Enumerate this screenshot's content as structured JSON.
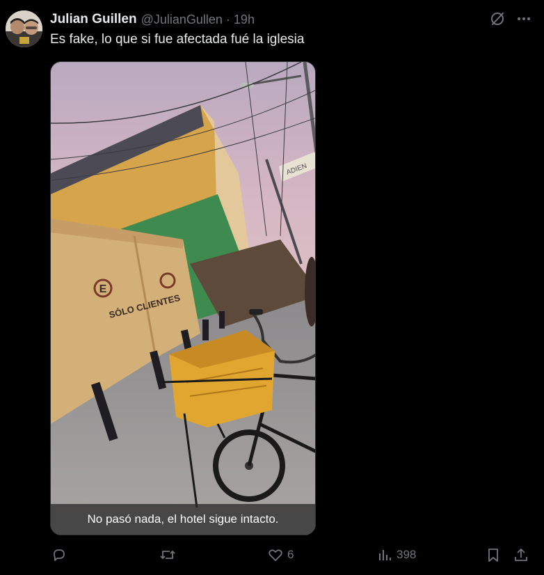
{
  "tweet": {
    "display_name": "Julian Guillen",
    "handle": "@JulianGullen",
    "separator": "·",
    "time": "19h",
    "text": "Es fake, lo que si fue afectada fué la iglesia",
    "more_icon": "more-horizontal-icon",
    "grok_icon": "grok-slash-icon"
  },
  "media": {
    "caption": "No pasó nada, el hotel sigue intacto.",
    "sign_line1": "SÓLO CLIENTES",
    "sign_letter": "E",
    "sign_overhead": "ADIEN"
  },
  "actions": {
    "reply_icon": "reply-icon",
    "repost_icon": "repost-icon",
    "like_icon": "heart-icon",
    "like_count": "6",
    "views_icon": "views-bar-chart-icon",
    "views_count": "398",
    "bookmark_icon": "bookmark-icon",
    "share_icon": "share-icon"
  },
  "colors": {
    "background": "#000000",
    "text_primary": "#e7e9ea",
    "text_secondary": "#71767b"
  }
}
